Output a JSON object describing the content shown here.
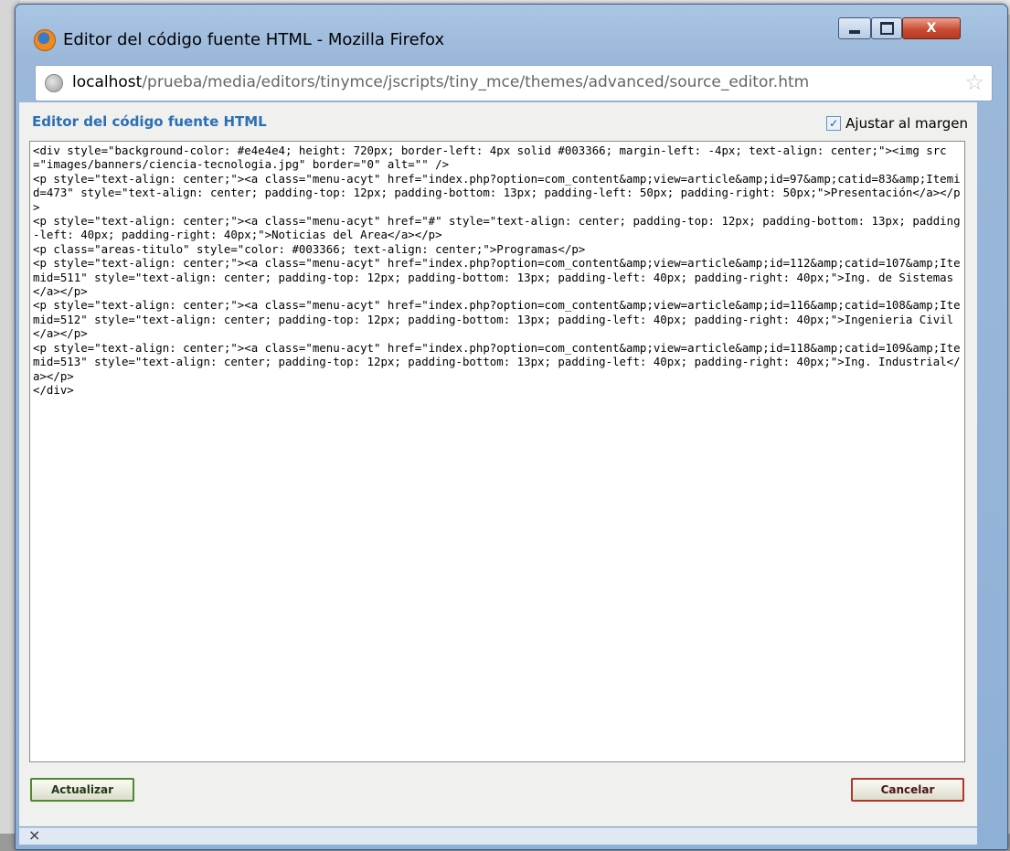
{
  "window": {
    "title": "Editor del código fuente HTML - Mozilla Firefox",
    "minimize_icon": "minimize-icon",
    "maximize_icon": "maximize-icon",
    "close_label": "X"
  },
  "urlbar": {
    "host": "localhost",
    "path": "/prueba/media/editors/tinymce/jscripts/tiny_mce/themes/advanced/source_editor.htm",
    "icons": [
      "globe-icon",
      "bookmark-star-icon"
    ]
  },
  "editor": {
    "title": "Editor del código fuente HTML",
    "wrap_label": "Ajustar al margen",
    "wrap_checked": true,
    "source_code": "<div style=\"background-color: #e4e4e4; height: 720px; border-left: 4px solid #003366; margin-left: -4px; text-align: center;\"><img src=\"images/banners/ciencia-tecnologia.jpg\" border=\"0\" alt=\"\" />\n<p style=\"text-align: center;\"><a class=\"menu-acyt\" href=\"index.php?option=com_content&amp;view=article&amp;id=97&amp;catid=83&amp;Itemid=473\" style=\"text-align: center; padding-top: 12px; padding-bottom: 13px; padding-left: 50px; padding-right: 50px;\">Presentación</a></p>\n<p style=\"text-align: center;\"><a class=\"menu-acyt\" href=\"#\" style=\"text-align: center; padding-top: 12px; padding-bottom: 13px; padding-left: 40px; padding-right: 40px;\">Noticias del Area</a></p>\n<p class=\"areas-titulo\" style=\"color: #003366; text-align: center;\">Programas</p>\n<p style=\"text-align: center;\"><a class=\"menu-acyt\" href=\"index.php?option=com_content&amp;view=article&amp;id=112&amp;catid=107&amp;Itemid=511\" style=\"text-align: center; padding-top: 12px; padding-bottom: 13px; padding-left: 40px; padding-right: 40px;\">Ing. de Sistemas</a></p>\n<p style=\"text-align: center;\"><a class=\"menu-acyt\" href=\"index.php?option=com_content&amp;view=article&amp;id=116&amp;catid=108&amp;Itemid=512\" style=\"text-align: center; padding-top: 12px; padding-bottom: 13px; padding-left: 40px; padding-right: 40px;\">Ingenieria Civil</a></p>\n<p style=\"text-align: center;\"><a class=\"menu-acyt\" href=\"index.php?option=com_content&amp;view=article&amp;id=118&amp;catid=109&amp;Itemid=513\" style=\"text-align: center; padding-top: 12px; padding-bottom: 13px; padding-left: 40px; padding-right: 40px;\">Ing. Industrial</a></p>\n</div>"
  },
  "buttons": {
    "update": "Actualizar",
    "cancel": "Cancelar"
  },
  "statusbar": {
    "close_glyph": "×"
  },
  "colors": {
    "accent_title": "#2b6fb4",
    "update_border": "#4e8a2a",
    "cancel_border": "#b3352a",
    "close_button": "#c94d33"
  }
}
